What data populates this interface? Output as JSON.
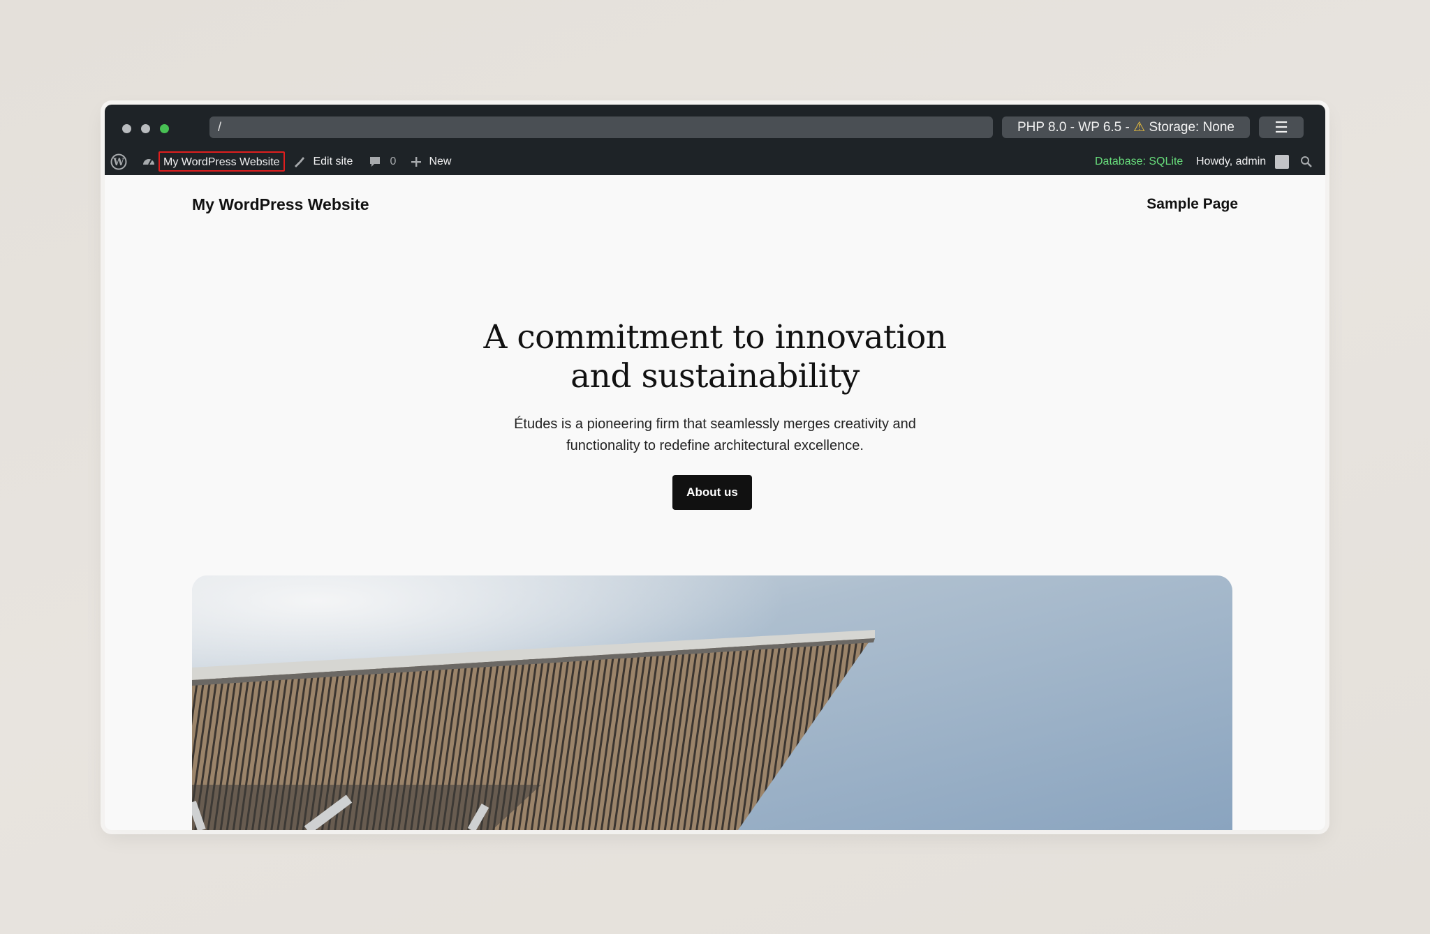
{
  "browser": {
    "url": "/",
    "env_prefix": "PHP 8.0 - WP 6.5 -",
    "env_storage": "Storage: None",
    "menu_glyph": "☰"
  },
  "adminbar": {
    "site_name": "My WordPress Website",
    "edit_site": "Edit site",
    "comment_count": "0",
    "new_label": "New",
    "database": "Database: SQLite",
    "howdy": "Howdy, admin"
  },
  "site": {
    "title": "My WordPress Website",
    "nav": [
      "Sample Page"
    ]
  },
  "hero": {
    "heading_line1": "A commitment to innovation",
    "heading_line2": "and sustainability",
    "text_line1": "Études is a pioneering firm that seamlessly merges creativity and",
    "text_line2": "functionality to redefine architectural excellence.",
    "button": "About us"
  },
  "colors": {
    "adminbar_bg": "#1e2327",
    "highlight_border": "#e01e1e",
    "database_green": "#68de7c",
    "warning_yellow": "#f0c33c",
    "button_bg": "#111111"
  }
}
